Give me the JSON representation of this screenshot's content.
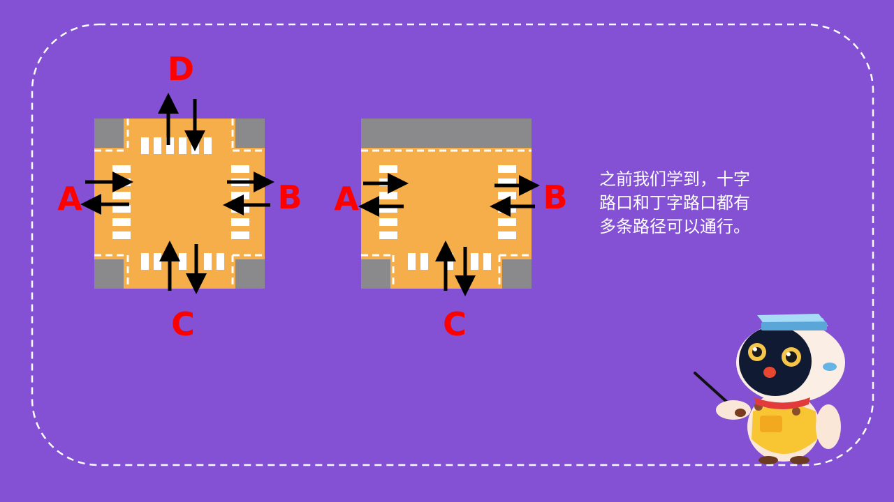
{
  "slide": {
    "background_color": "#8451d4",
    "border_color": "#ffffff"
  },
  "colors": {
    "road": "#f5ae49",
    "corner_block": "#8a8a8d",
    "marking": "#ffffff",
    "arrow": "#000000",
    "label": "#ff0000"
  },
  "crossroad": {
    "label_a": "A",
    "label_b": "B",
    "label_c": "C",
    "label_d": "D"
  },
  "t_junction": {
    "label_a": "A",
    "label_b": "B",
    "label_c": "C"
  },
  "caption": {
    "text": "之前我们学到，十字\n路口和丁字路口都有\n多条路径可以通行。"
  },
  "mascot": {
    "icon": "robot-teacher-mascot-icon"
  }
}
